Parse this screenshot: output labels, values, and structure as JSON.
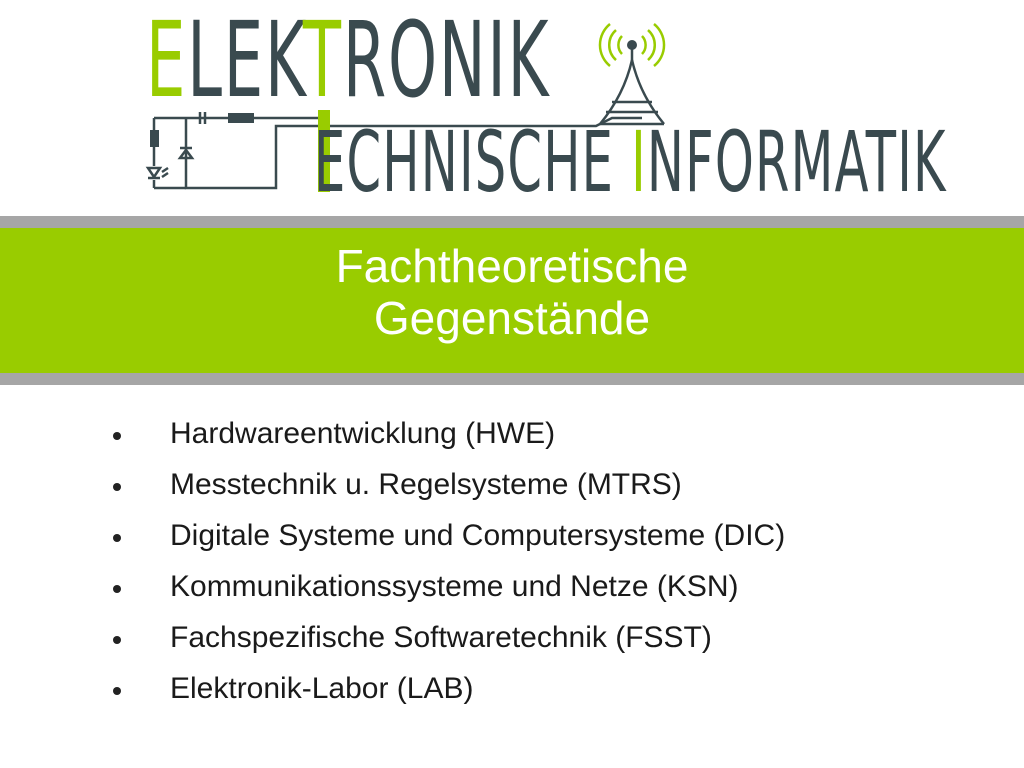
{
  "logo": {
    "line1": {
      "accent": "E",
      "rest1": "LEK",
      "accent2": "T",
      "rest2": "RONIK"
    },
    "line2": {
      "rest1": "ECHNISCHE ",
      "accent": "I",
      "rest2": "NFORMATIK"
    },
    "antenna_icon": "radio-antenna-icon",
    "circuit_icon": "circuit-schematic-icon"
  },
  "banner": {
    "title_line1": "Fachtheoretische",
    "title_line2": "Gegenstände"
  },
  "topics": [
    {
      "label": "Hardwareentwicklung (HWE)"
    },
    {
      "label": "Messtechnik u. Regelsysteme (MTRS)"
    },
    {
      "label": "Digitale Systeme und Computersysteme (DIC)"
    },
    {
      "label": "Kommunikationssysteme und Netze (KSN)"
    },
    {
      "label": "Fachspezifische Softwaretechnik (FSST)"
    },
    {
      "label": "Elektronik-Labor (LAB)"
    }
  ],
  "colors": {
    "accent": "#99cc00",
    "logo_text": "#3a4a4f",
    "banner_border": "#a6a6a6",
    "banner_text": "#ffffff",
    "body_text": "#1a1a1a"
  }
}
